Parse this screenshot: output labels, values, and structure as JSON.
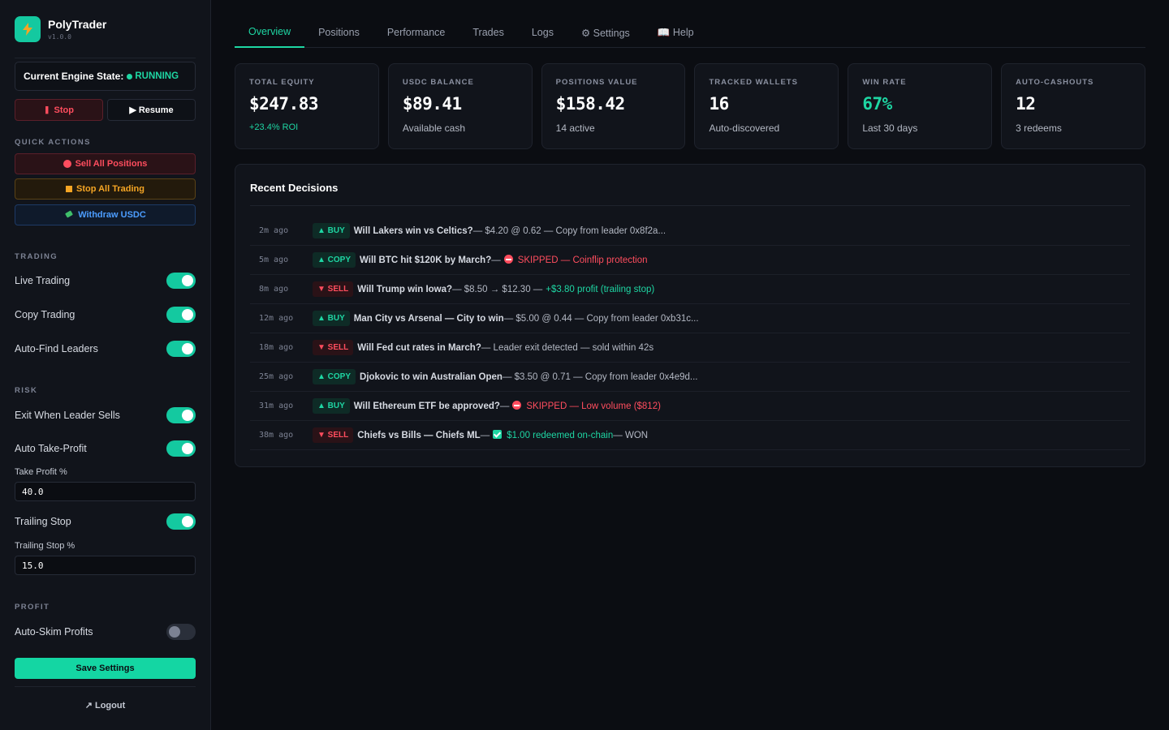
{
  "brand": {
    "name": "PolyTrader",
    "version": "v1.0.0"
  },
  "engine": {
    "label": "Current Engine State:",
    "state": "RUNNING"
  },
  "controls": {
    "stop": "Stop",
    "resume": "▶ Resume"
  },
  "quick_actions": {
    "label": "QUICK ACTIONS",
    "sell_all": "Sell All Positions",
    "stop_all": "Stop All Trading",
    "withdraw": "Withdraw USDC"
  },
  "trading": {
    "label": "TRADING",
    "live_trading": {
      "label": "Live Trading",
      "on": true
    },
    "copy_trading": {
      "label": "Copy Trading",
      "on": true
    },
    "auto_find": {
      "label": "Auto-Find Leaders",
      "on": true
    }
  },
  "risk": {
    "label": "RISK",
    "exit_leader": {
      "label": "Exit When Leader Sells",
      "on": true
    },
    "auto_tp": {
      "label": "Auto Take-Profit",
      "on": true
    },
    "take_profit_label": "Take Profit %",
    "take_profit_value": "40.0",
    "trailing_stop": {
      "label": "Trailing Stop",
      "on": true
    },
    "trailing_stop_label": "Trailing Stop %",
    "trailing_stop_value": "15.0"
  },
  "profit": {
    "label": "PROFIT",
    "auto_skim": {
      "label": "Auto-Skim Profits",
      "on": false
    }
  },
  "save_label": "Save Settings",
  "logout_label": "↗ Logout",
  "tabs": [
    "Overview",
    "Positions",
    "Performance",
    "Trades",
    "Logs",
    "⚙ Settings",
    "📖 Help"
  ],
  "stats": [
    {
      "label": "TOTAL EQUITY",
      "value": "$247.83",
      "sub": "+23.4% ROI"
    },
    {
      "label": "USDC BALANCE",
      "value": "$89.41",
      "sub": "Available cash"
    },
    {
      "label": "POSITIONS VALUE",
      "value": "$158.42",
      "sub": "14 active"
    },
    {
      "label": "TRACKED WALLETS",
      "value": "16",
      "sub": "Auto-discovered"
    },
    {
      "label": "WIN RATE",
      "value": "67%",
      "sub": "Last 30 days"
    },
    {
      "label": "AUTO-CASHOUTS",
      "value": "12",
      "sub": "3 redeems"
    }
  ],
  "decisions": {
    "title": "Recent Decisions",
    "rows": [
      {
        "time": "2m ago",
        "action": "▲ BUY",
        "title": "Will Lakers win vs Celtics?",
        "detail": " — $4.20 @ 0.62 — Copy from leader 0x8f2a...",
        "highlight": "",
        "extra": ""
      },
      {
        "time": "5m ago",
        "action": "▲ COPY",
        "title": "Will BTC hit $120K by March?",
        "detail": " —",
        "highlight": "SKIPPED — Coinflip protection",
        "extra": ""
      },
      {
        "time": "8m ago",
        "action": "▼ SELL",
        "title": "Will Trump win Iowa?",
        "detail": " — $8.50 → $12.30 —",
        "highlight": "+$3.80 profit (trailing stop)",
        "extra": ""
      },
      {
        "time": "12m ago",
        "action": "▲ BUY",
        "title": "Man City vs Arsenal — City to win",
        "detail": " — $5.00 @ 0.44 — Copy from leader 0xb31c...",
        "highlight": "",
        "extra": ""
      },
      {
        "time": "18m ago",
        "action": "▼ SELL",
        "title": "Will Fed cut rates in March?",
        "detail": " — Leader exit detected — sold within 42s",
        "highlight": "",
        "extra": ""
      },
      {
        "time": "25m ago",
        "action": "▲ COPY",
        "title": "Djokovic to win Australian Open",
        "detail": " — $3.50 @ 0.71 — Copy from leader 0x4e9d...",
        "highlight": "",
        "extra": ""
      },
      {
        "time": "31m ago",
        "action": "▲ BUY",
        "title": "Will Ethereum ETF be approved?",
        "detail": " —",
        "highlight": "SKIPPED — Low volume ($812)",
        "extra": ""
      },
      {
        "time": "38m ago",
        "action": "▼ SELL",
        "title": "Chiefs vs Bills — Chiefs ML",
        "detail": " —",
        "highlight": "$1.00 redeemed on-chain",
        "extra": " — WON"
      }
    ]
  },
  "colors": {
    "accent": "#1ed6a3",
    "danger": "#ff4d5e",
    "warning": "#f5a524",
    "info": "#4c9dff"
  }
}
